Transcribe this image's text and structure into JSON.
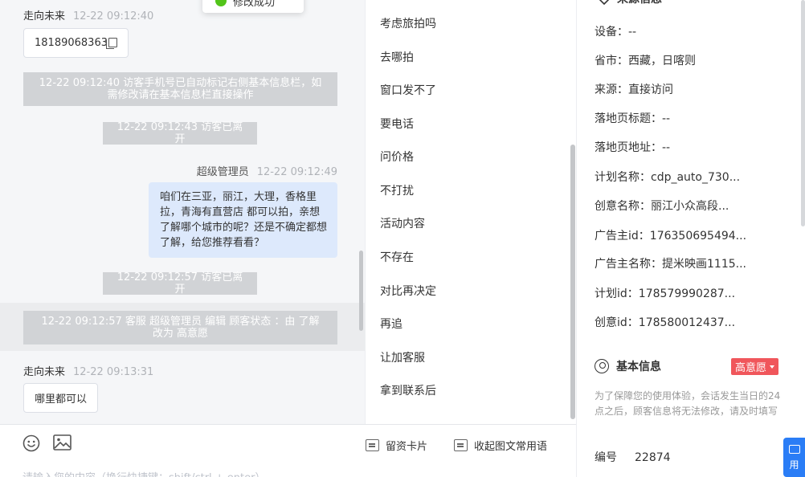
{
  "toast": {
    "text": "修改成功"
  },
  "chat": {
    "msg1": {
      "sender": "走向未来",
      "time": "12-22 09:12:40",
      "text": "18189068363"
    },
    "sys1": "12-22 09:12:40 访客手机号已自动标记右侧基本信息栏，如需修改请在基本信息栏直接操作",
    "sys2": "12-22 09:12:43 访客已离开",
    "msg2": {
      "sender": "超级管理员",
      "time": "12-22 09:12:49",
      "text": "咱们在三亚，丽江，大理，香格里拉，青海有直营店 都可以拍，亲想了解哪个城市的呢？还是不确定都想了解，给您推荐看看？"
    },
    "sys3": "12-22 09:12:57 访客已离开",
    "sys4": "12-22 09:12:57 客服 超级管理员 编辑 顾客状态 ：由 了解 改为 高意愿",
    "msg3": {
      "sender": "走向未来",
      "time": "12-22 09:13:31",
      "text": "哪里都可以"
    }
  },
  "input": {
    "placeholder": "请输入您的内容（换行快捷键：shift/ctrl + enter）",
    "leave_card": "留资卡片",
    "collapse_phrases": "收起图文常用语"
  },
  "phrases": [
    "考虑旅拍吗",
    "去哪拍",
    "窗口发不了",
    "要电话",
    "问价格",
    "不打扰",
    "活动内容",
    "不存在",
    "对比再决定",
    "再追",
    "让加客服",
    "拿到联系后"
  ],
  "info": {
    "source_title": "来源信息",
    "rows": [
      {
        "label": "设备：",
        "value": "--"
      },
      {
        "label": "省市：",
        "value": "西藏，日喀则"
      },
      {
        "label": "来源：",
        "value": "直接访问"
      },
      {
        "label": "落地页标题：",
        "value": "--"
      },
      {
        "label": "落地页地址：",
        "value": "--"
      },
      {
        "label": "计划名称：",
        "value": "cdp_auto_730..."
      },
      {
        "label": "创意名称：",
        "value": "丽江小众高段..."
      },
      {
        "label": "广告主id：",
        "value": "176350695494..."
      },
      {
        "label": "广告主名称：",
        "value": "提米映画1115..."
      },
      {
        "label": "计划id：",
        "value": "178579990287..."
      },
      {
        "label": "创意id：",
        "value": "178580012437..."
      }
    ],
    "basic_title": "基本信息",
    "intent_tag": "高意愿",
    "note": "为了保障您的使用体验，会话发生当日的24点之后，顾客信息将无法修改，请及时填写",
    "id_label": "编号",
    "id_value": "22874"
  },
  "float_button": {
    "label": "用"
  },
  "colors": {
    "accent": "#2a7df6",
    "tag_red": "#f0565b",
    "bubble_blue": "#dde9fc",
    "system_gray": "#d1d3d6"
  }
}
